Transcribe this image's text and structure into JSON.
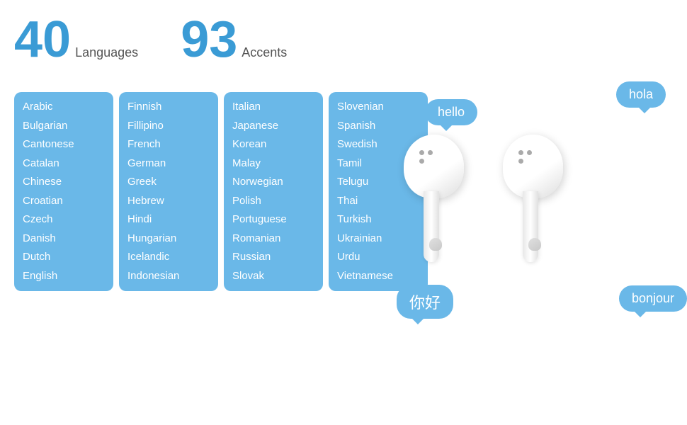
{
  "stats": {
    "languages_number": "40",
    "languages_label": "Languages",
    "accents_number": "93",
    "accents_label": "Accents"
  },
  "columns": [
    {
      "id": "col1",
      "items": [
        "Arabic",
        "Bulgarian",
        "Cantonese",
        "Catalan",
        "Chinese",
        "Croatian",
        "Czech",
        "Danish",
        "Dutch",
        "English"
      ]
    },
    {
      "id": "col2",
      "items": [
        "Finnish",
        "Fillipino",
        "French",
        "German",
        "Greek",
        "Hebrew",
        "Hindi",
        "Hungarian",
        "Icelandic",
        "Indonesian"
      ]
    },
    {
      "id": "col3",
      "items": [
        "Italian",
        "Japanese",
        "Korean",
        "Malay",
        "Norwegian",
        "Polish",
        "Portuguese",
        "Romanian",
        "Russian",
        "Slovak"
      ]
    },
    {
      "id": "col4",
      "items": [
        "Slovenian",
        "Spanish",
        "Swedish",
        "Tamil",
        "Telugu",
        "Thai",
        "Turkish",
        "Ukrainian",
        "Urdu",
        "Vietnamese"
      ]
    }
  ],
  "bubbles": {
    "hello": "hello",
    "hola": "hola",
    "nihao": "你好",
    "bonjour": "bonjour"
  }
}
